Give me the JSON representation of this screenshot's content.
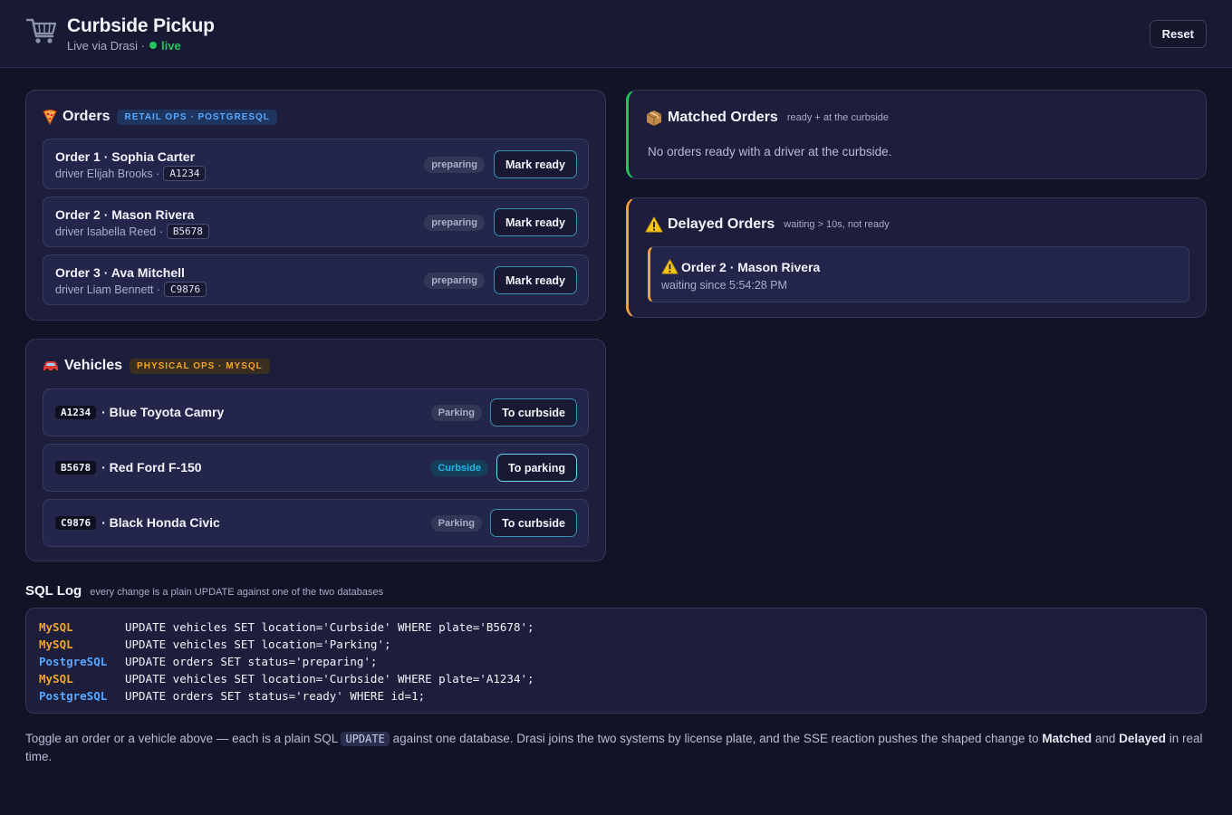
{
  "header": {
    "title": "Curbside Pickup",
    "subtitle": "Live via Drasi ·",
    "live_label": "live",
    "reset_label": "Reset",
    "logo_icon": "shopping-cart-icon"
  },
  "orders": {
    "title": "Orders",
    "tag": "RETAIL OPS · POSTGRESQL",
    "icon": "pizza-icon",
    "items": [
      {
        "title": "Order 1 · Sophia Carter",
        "driver": "driver Elijah Brooks ·",
        "plate": "A1234",
        "status": "preparing",
        "action": "Mark ready"
      },
      {
        "title": "Order 2 · Mason Rivera",
        "driver": "driver Isabella Reed ·",
        "plate": "B5678",
        "status": "preparing",
        "action": "Mark ready"
      },
      {
        "title": "Order 3 · Ava Mitchell",
        "driver": "driver Liam Bennett ·",
        "plate": "C9876",
        "status": "preparing",
        "action": "Mark ready"
      }
    ]
  },
  "vehicles": {
    "title": "Vehicles",
    "tag": "PHYSICAL OPS · MYSQL",
    "icon": "car-icon",
    "items": [
      {
        "plate": "A1234",
        "name": "· Blue Toyota Camry",
        "status": "Parking",
        "action": "To curbside"
      },
      {
        "plate": "B5678",
        "name": "· Red Ford F-150",
        "status": "Curbside",
        "action": "To parking"
      },
      {
        "plate": "C9876",
        "name": "· Black Honda Civic",
        "status": "Parking",
        "action": "To curbside"
      }
    ]
  },
  "matched": {
    "title": "Matched Orders",
    "note": "ready + at the curbside",
    "empty": "No orders ready with a driver at the curbside.",
    "icon": "package-icon"
  },
  "delayed": {
    "title": "Delayed Orders",
    "note": "waiting > 10s, not ready",
    "icon": "warning-icon",
    "items": [
      {
        "title": "Order 2 · Mason Rivera",
        "since": "waiting since 5:54:28 PM"
      }
    ]
  },
  "sql_log": {
    "title": "SQL Log",
    "note": "every change is a plain UPDATE against one of the two databases",
    "entries": [
      {
        "db": "MySQL",
        "stmt": "UPDATE vehicles SET location='Curbside' WHERE plate='B5678';"
      },
      {
        "db": "MySQL",
        "stmt": "UPDATE vehicles SET location='Parking';"
      },
      {
        "db": "PostgreSQL",
        "stmt": "UPDATE orders SET status='preparing';"
      },
      {
        "db": "MySQL",
        "stmt": "UPDATE vehicles SET location='Curbside' WHERE plate='A1234';"
      },
      {
        "db": "PostgreSQL",
        "stmt": "UPDATE orders SET status='ready' WHERE id=1;"
      }
    ]
  },
  "footer": {
    "part1": "Toggle an order or a vehicle above — each is a plain SQL",
    "code": "UPDATE",
    "part2": "against one database. Drasi joins the two systems by license plate, and the SSE reaction pushes the shaped change to",
    "matched": "Matched",
    "and": "and",
    "delayed": "Delayed",
    "part3": "in real time."
  },
  "colors": {
    "background": "#121327",
    "panel": "#1c1e3b",
    "live": "#22c55e",
    "mysql": "#f5a524",
    "postgresql": "#5aa7ff",
    "curbside": "#22b8e6",
    "delayed_accent": "#f59e3b"
  }
}
